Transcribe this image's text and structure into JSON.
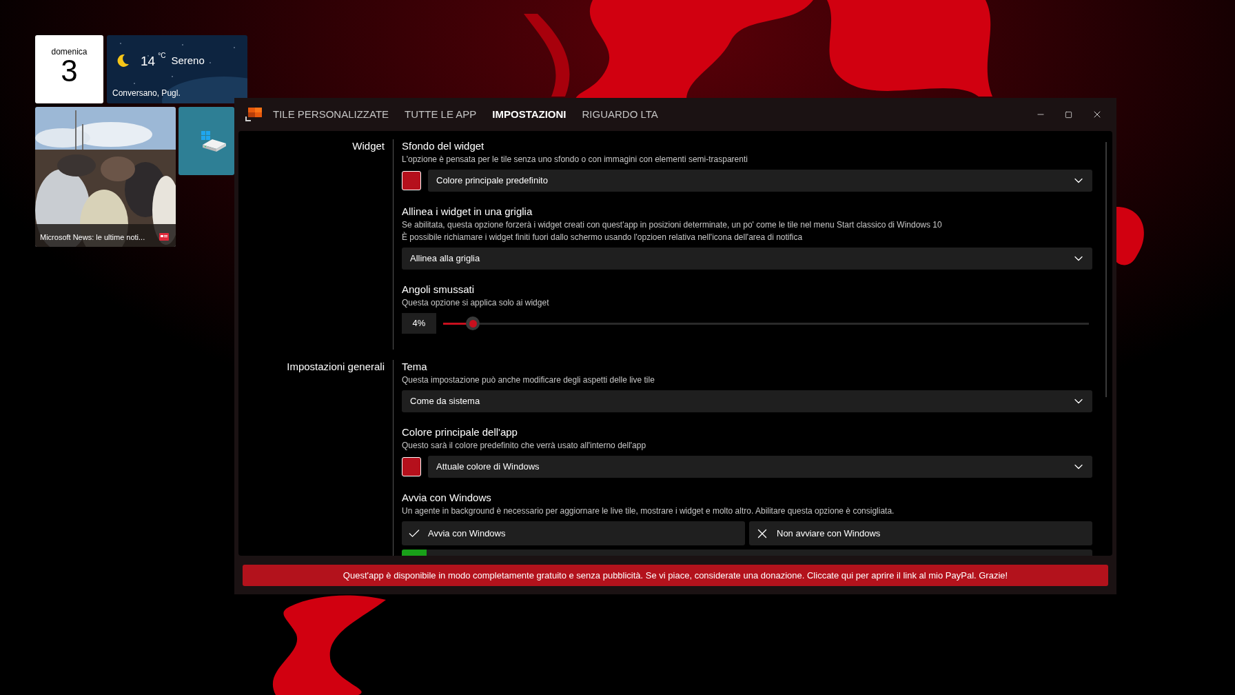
{
  "tiles": [
    {
      "kind": "date",
      "day_name": "domenica",
      "day": "3"
    },
    {
      "kind": "weather",
      "temperature": "14",
      "unit": "°C",
      "condition": "Sereno",
      "location": "Conversano, Pugl."
    },
    {
      "kind": "news",
      "caption": "Microsoft News: le ultime noti..."
    },
    {
      "kind": "app"
    }
  ],
  "window": {
    "tabs": [
      {
        "label": "TILE PERSONALIZZATE",
        "selected": false
      },
      {
        "label": "TUTTE LE APP",
        "selected": false
      },
      {
        "label": "IMPOSTAZIONI",
        "selected": true
      },
      {
        "label": "RIGUARDO LTA",
        "selected": false
      }
    ],
    "sections": [
      {
        "label": "Widget",
        "settings": [
          {
            "kind": "color_dropdown",
            "title": "Sfondo del widget",
            "description": [
              "L'opzione è pensata per le tile senza uno sfondo o con immagini con elementi semi-trasparenti"
            ],
            "color": "#b5101c",
            "value": "Colore principale predefinito"
          },
          {
            "kind": "dropdown",
            "title": "Allinea i widget in una griglia",
            "description": [
              "Se abilitata, questa opzione forzerà i widget creati con quest'app in posizioni determinate, un po' come le tile nel menu Start classico di Windows 10",
              "È possibile richiamare i widget finiti fuori dallo schermo usando l'opzioen relativa nell'icona dell'area di notifica"
            ],
            "value": "Allinea alla griglia"
          },
          {
            "kind": "slider",
            "title": "Angoli smussati",
            "description": [
              "Questa opzione si applica solo ai widget"
            ],
            "reading": "4%",
            "level": 0.04
          }
        ]
      },
      {
        "label": "Impostazioni generali",
        "settings": [
          {
            "kind": "dropdown",
            "title": "Tema",
            "description": [
              "Questa impostazione può anche modificare degli aspetti delle live tile"
            ],
            "value": "Come da sistema"
          },
          {
            "kind": "color_dropdown",
            "title": "Colore principale dell'app",
            "description": [
              "Questo sarà il colore predefinito che verrà usato all'interno dell'app"
            ],
            "color": "#b5101c",
            "value": "Attuale colore di Windows"
          },
          {
            "kind": "choice",
            "title": "Avvia con Windows",
            "description": [
              "Un agente in background è necessario per aggiornare le live tile, mostrare i widget e molto altro. Abilitare questa opzione è consigliata."
            ],
            "options": [
              {
                "label": "Avvia con Windows"
              },
              {
                "label": "Non avviare con Windows"
              }
            ]
          }
        ]
      }
    ],
    "banner": "Quest'app è disponibile in modo completamente gratuito e senza pubblicità. Se vi piace, considerate una donazione. Cliccate qui per aprire il link al mio PayPal. Grazie!"
  }
}
